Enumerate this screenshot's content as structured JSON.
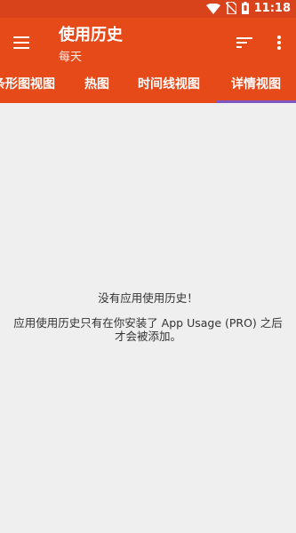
{
  "status_bar": {
    "time": "11:18",
    "icons": [
      "wifi-icon",
      "no-sim-icon",
      "battery-icon"
    ]
  },
  "app_bar": {
    "title": "使用历史",
    "subtitle": "每天",
    "menu_icon": "hamburger-menu-icon",
    "sort_icon": "sort-icon",
    "more_icon": "more-vert-icon"
  },
  "tabs": [
    {
      "label": "条形图视图",
      "selected": false
    },
    {
      "label": "热图",
      "selected": false
    },
    {
      "label": "时间线视图",
      "selected": false
    },
    {
      "label": "详情视图",
      "selected": true
    }
  ],
  "empty_state": {
    "title": "没有应用使用历史！",
    "message": "应用使用历史只有在你安装了 App Usage (PRO) 之后才会被添加。"
  },
  "colors": {
    "status_bar": "#d8431c",
    "app_bar": "#e64a19",
    "tab_indicator": "#7e57c2",
    "background": "#efefef"
  }
}
